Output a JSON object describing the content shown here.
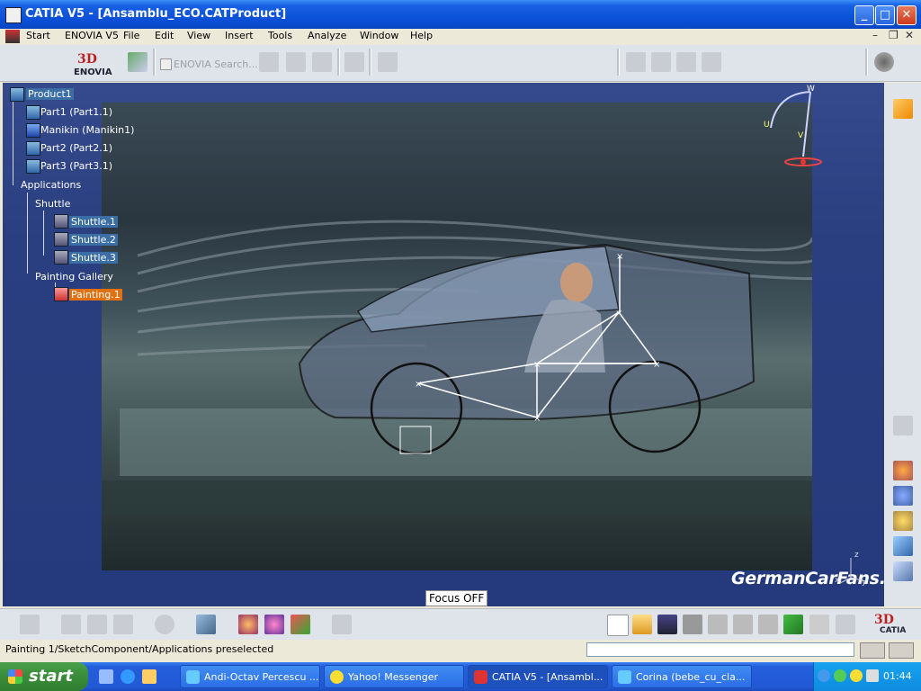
{
  "window": {
    "title": "CATIA V5 - [Ansamblu_ECO.CATProduct]",
    "minimize": "_",
    "maximize": "□",
    "close": "✕"
  },
  "menu": {
    "items": [
      "Start",
      "ENOVIA V5",
      "File",
      "Edit",
      "View",
      "Insert",
      "Tools",
      "Analyze",
      "Window",
      "Help"
    ]
  },
  "toolbar": {
    "enovia_logo": "ENOVIA",
    "enovia_search_label": "ENOVIA Search..."
  },
  "tree": {
    "nodes": [
      {
        "label": "Product1",
        "level": 0
      },
      {
        "label": "Part1 (Part1.1)",
        "level": 1
      },
      {
        "label": "Manikin (Manikin1)",
        "level": 1
      },
      {
        "label": "Part2 (Part2.1)",
        "level": 1
      },
      {
        "label": "Part3 (Part3.1)",
        "level": 1
      },
      {
        "label": "Applications",
        "level": 0
      },
      {
        "label": "Shuttle",
        "level": 1
      },
      {
        "label": "Shuttle.1",
        "level": 2
      },
      {
        "label": "Shuttle.2",
        "level": 2
      },
      {
        "label": "Shuttle.3",
        "level": 2
      },
      {
        "label": "Painting Gallery",
        "level": 1
      },
      {
        "label": "Painting.1",
        "level": 2
      }
    ]
  },
  "viewport": {
    "focus_label": "Focus OFF",
    "watermark": "GermanCarFans.com",
    "compass_labels": {
      "w": "W",
      "u": "U",
      "v": "V"
    },
    "axis_labels": {
      "x": "x",
      "y": "y",
      "z": "z"
    }
  },
  "bottom_toolbar": {
    "catia_logo": "CATIA"
  },
  "status": {
    "text": "Painting 1/SketchComponent/Applications preselected",
    "command_input": ""
  },
  "taskbar": {
    "start_label": "start",
    "tasks": [
      {
        "label": "Andi-Octav Percescu ...",
        "active": false
      },
      {
        "label": "Yahoo! Messenger",
        "active": false
      },
      {
        "label": "CATIA V5 - [Ansambl...",
        "active": true
      },
      {
        "label": "Corina (bebe_cu_cla...",
        "active": false
      }
    ],
    "clock": "01:44"
  },
  "colors": {
    "titlebar": "#0a4fd6",
    "selection_orange": "#e07010",
    "viewport_bg": "#2a3f80",
    "taskbar": "#245edb",
    "start_green": "#3c8f3c"
  }
}
